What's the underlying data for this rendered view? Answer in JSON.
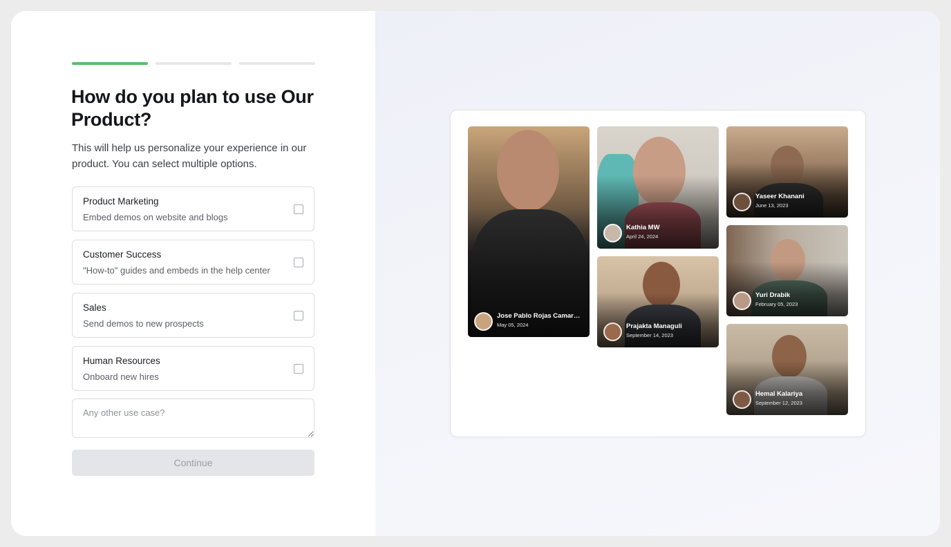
{
  "progress": {
    "steps": 3,
    "current": 1
  },
  "heading": "How do you plan to use Our Product?",
  "subtitle": "This will help us personalize your experience in our product. You can select multiple options.",
  "options": [
    {
      "title": "Product Marketing",
      "description": "Embed demos on website and blogs",
      "checked": false
    },
    {
      "title": "Customer Success",
      "description": "\"How-to\" guides and embeds in the help center",
      "checked": false
    },
    {
      "title": "Sales",
      "description": "Send demos to new prospects",
      "checked": false
    },
    {
      "title": "Human Resources",
      "description": "Onboard new hires",
      "checked": false
    }
  ],
  "other_use_case": {
    "placeholder": "Any other use case?",
    "value": ""
  },
  "continue_label": "Continue",
  "videos": [
    {
      "name": "Jose Pablo Rojas Camar…",
      "date": "May 05, 2024",
      "bg": "#6b5a44"
    },
    {
      "name": "Kathia MW",
      "date": "April 24, 2024",
      "bg": "#cbc5bd"
    },
    {
      "name": "Prajakta Managuli",
      "date": "September 14, 2023",
      "bg": "#b89a7e"
    },
    {
      "name": "Yaseer Khanani",
      "date": "June 13, 2023",
      "bg": "#8b7660"
    },
    {
      "name": "Yuri Drabik",
      "date": "February 05, 2023",
      "bg": "#a8a196"
    },
    {
      "name": "Hemal Kalariya",
      "date": "September 12, 2023",
      "bg": "#a39583"
    }
  ],
  "colors": {
    "accent": "#5bbd6c",
    "progress_track": "#e6e7ea",
    "button_disabled": "#e4e5e8"
  }
}
